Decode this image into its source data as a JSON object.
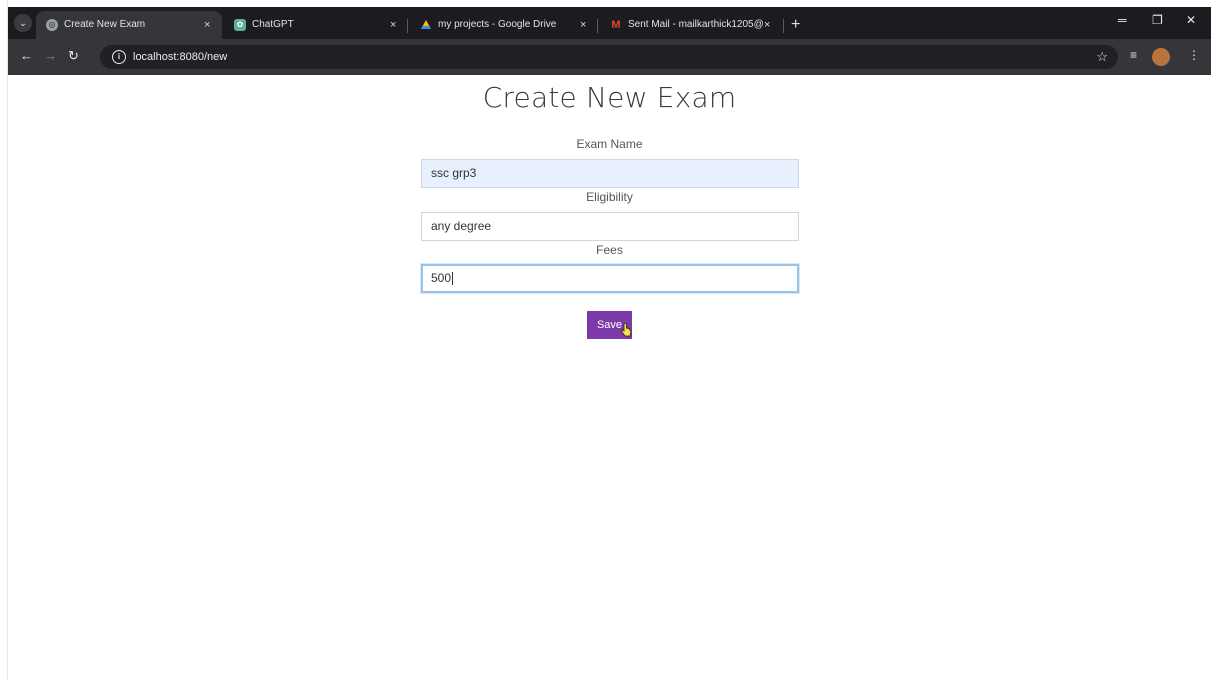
{
  "browser": {
    "tabs": [
      {
        "title": "Create New Exam",
        "icon": "globe-icon",
        "active": true
      },
      {
        "title": "ChatGPT",
        "icon": "chatgpt-icon",
        "active": false
      },
      {
        "title": "my projects - Google Drive",
        "icon": "google-drive-icon",
        "active": false
      },
      {
        "title": "Sent Mail - mailkarthick1205@",
        "icon": "gmail-icon",
        "active": false
      }
    ],
    "url": "localhost:8080/new",
    "new_tab_symbol": "+",
    "close_symbol": "×"
  },
  "form": {
    "title": "Create New Exam",
    "fields": [
      {
        "label": "Exam Name",
        "value": "ssc grp3"
      },
      {
        "label": "Eligibility",
        "value": "any degree"
      },
      {
        "label": "Fees",
        "value": "500"
      }
    ],
    "save_label": "Save"
  },
  "colors": {
    "save_button": "#7c3aa8",
    "autofill_background": "#e8f0fe",
    "focus_border": "#9dc2e8"
  }
}
